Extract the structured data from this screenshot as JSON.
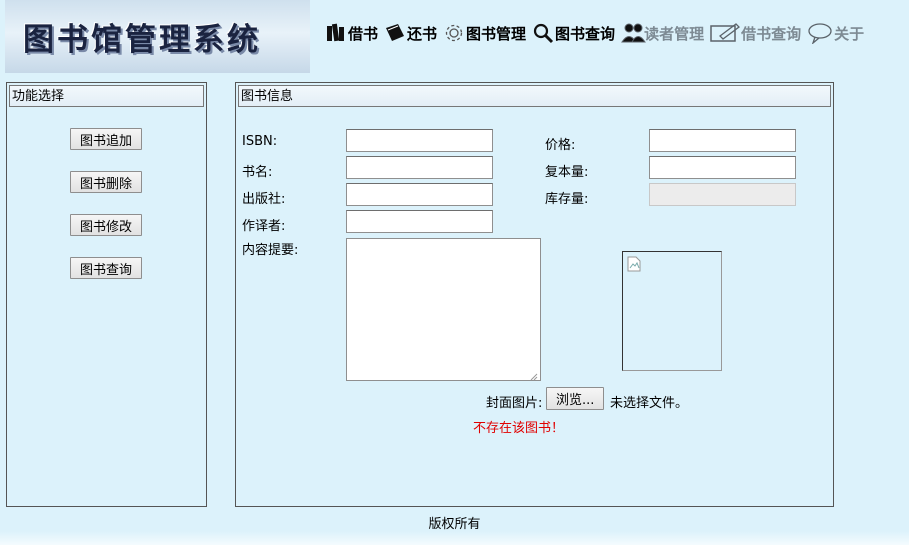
{
  "header": {
    "logo_text": "图书馆管理系统",
    "nav": [
      {
        "label": "借书",
        "icon": "books-icon",
        "disabled": false
      },
      {
        "label": "还书",
        "icon": "book-return-icon",
        "disabled": false
      },
      {
        "label": "图书管理",
        "icon": "gear-icon",
        "disabled": false
      },
      {
        "label": "图书查询",
        "icon": "search-icon",
        "disabled": false
      },
      {
        "label": "读者管理",
        "icon": "users-icon",
        "disabled": true
      },
      {
        "label": "借书查询",
        "icon": "edit-icon",
        "disabled": true
      },
      {
        "label": "关于",
        "icon": "speech-bubble-icon",
        "disabled": true
      }
    ]
  },
  "left_panel": {
    "title": "功能选择",
    "buttons": [
      "图书追加",
      "图书删除",
      "图书修改",
      "图书查询"
    ]
  },
  "right_panel": {
    "title": "图书信息",
    "fields": {
      "isbn": {
        "label": "ISBN:",
        "value": ""
      },
      "title": {
        "label": "书名:",
        "value": ""
      },
      "publisher": {
        "label": "出版社:",
        "value": ""
      },
      "author": {
        "label": "作译者:",
        "value": ""
      },
      "summary": {
        "label": "内容提要:",
        "value": ""
      },
      "price": {
        "label": "价格:",
        "value": ""
      },
      "copies": {
        "label": "复本量:",
        "value": ""
      },
      "stock": {
        "label": "库存量:",
        "value": ""
      }
    },
    "cover": {
      "label": "封面图片:",
      "browse_label": "浏览...",
      "file_status": "未选择文件。"
    },
    "error_message": "不存在该图书！"
  },
  "footer": {
    "text": "版权所有"
  },
  "colors": {
    "background": "#dcf2fb",
    "error": "#e00000"
  }
}
